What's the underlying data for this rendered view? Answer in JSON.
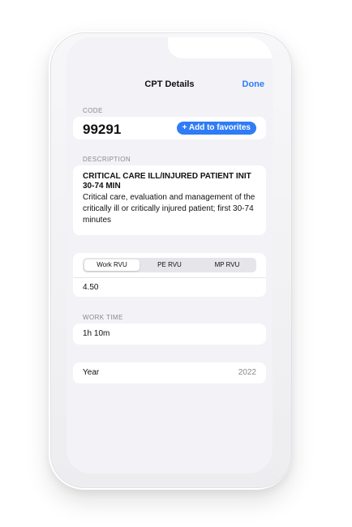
{
  "nav": {
    "title": "CPT Details",
    "done_label": "Done"
  },
  "code_section": {
    "label": "CODE",
    "value": "99291",
    "favorites_label": "+ Add to favorites"
  },
  "description_section": {
    "label": "DESCRIPTION",
    "title": "CRITICAL CARE ILL/INJURED PATIENT INIT 30-74 MIN",
    "text": "Critical care, evaluation and management of the critically ill or critically injured patient; first 30-74 minutes"
  },
  "rvu_section": {
    "tabs": [
      {
        "label": "Work RVU",
        "active": true
      },
      {
        "label": "PE RVU",
        "active": false
      },
      {
        "label": "MP RVU",
        "active": false
      }
    ],
    "value": "4.50"
  },
  "work_time_section": {
    "label": "WORK TIME",
    "value": "1h 10m"
  },
  "year_row": {
    "label": "Year",
    "value": "2022"
  },
  "colors": {
    "accent": "#2f7cf6",
    "background": "#f2f2f7",
    "card": "#ffffff",
    "secondary_text": "#8a8a8e"
  }
}
